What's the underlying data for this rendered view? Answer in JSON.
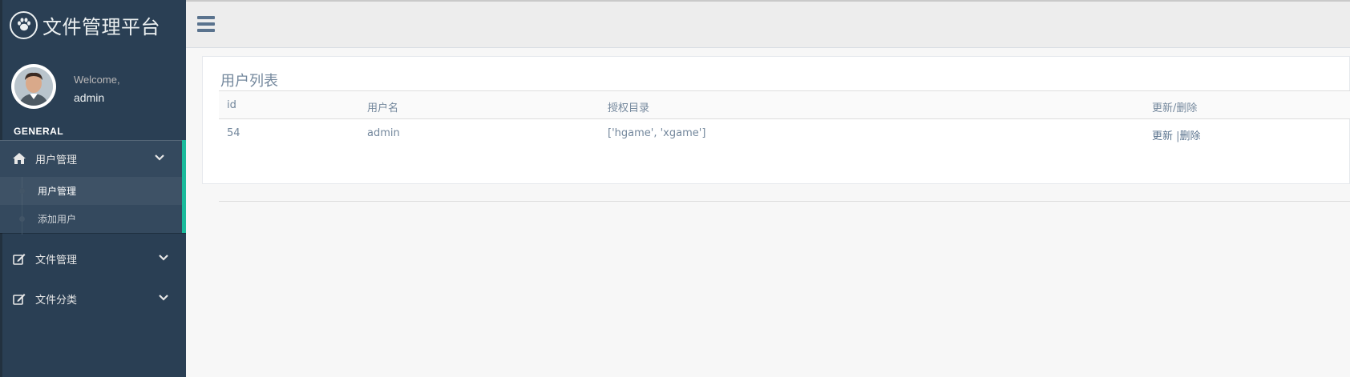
{
  "app": {
    "title": "文件管理平台"
  },
  "profile": {
    "welcome": "Welcome,",
    "username": "admin"
  },
  "sidebar": {
    "section_title": "GENERAL",
    "groups": [
      {
        "label": "用户管理",
        "icon": "home-icon",
        "expanded": true,
        "items": [
          {
            "label": "用户管理",
            "current": true
          },
          {
            "label": "添加用户",
            "current": false
          }
        ]
      },
      {
        "label": "文件管理",
        "icon": "edit-icon",
        "expanded": false,
        "items": []
      },
      {
        "label": "文件分类",
        "icon": "edit-icon",
        "expanded": false,
        "items": []
      }
    ]
  },
  "topnav": {
    "menu_icon": "hamburger-icon"
  },
  "main": {
    "panel_title": "用户列表",
    "table": {
      "headers": {
        "id": "id",
        "name": "用户名",
        "dirs": "授权目录",
        "actions": "更新/删除"
      },
      "rows": [
        {
          "id": "54",
          "name": "admin",
          "dirs": "['hgame', 'xgame']",
          "update": "更新",
          "sep": " |",
          "delete": "删除"
        }
      ]
    }
  },
  "colors": {
    "sidebar_bg": "#2a3f54",
    "accent": "#1abb9c",
    "topnav_bg": "#ededed",
    "text": "#73879c"
  }
}
